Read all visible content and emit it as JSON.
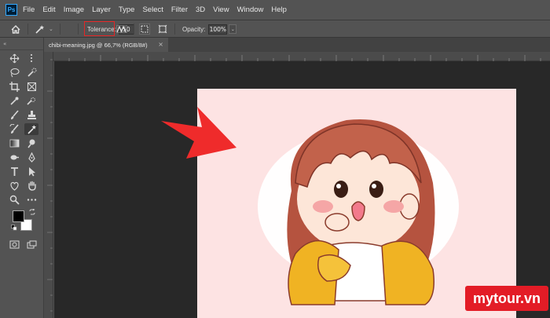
{
  "app": {
    "logo_text": "Ps"
  },
  "menu": [
    "File",
    "Edit",
    "Image",
    "Layer",
    "Type",
    "Select",
    "Filter",
    "3D",
    "View",
    "Window",
    "Help"
  ],
  "options": {
    "tolerance_label": "Tolerance:",
    "tolerance_value": "50",
    "opacity_label": "Opacity:",
    "opacity_value": "100%"
  },
  "document": {
    "tab_title": "chibi-meaning.jpg @ 66,7% (RGB/8#)",
    "tab_close": "×"
  },
  "colors": {
    "foreground": "#000000",
    "background": "#ffffff",
    "highlight_box": "#e52525",
    "arrow": "#ef2b2b",
    "canvas_bg": "#fde3e3"
  },
  "watermark": {
    "text": "mytour.vn"
  },
  "tools": [
    "move-tool",
    "artboard-tool",
    "lasso-tool",
    "quick-selection-tool",
    "crop-tool",
    "frame-tool",
    "eyedropper-tool",
    "spot-healing-tool",
    "brush-tool",
    "clone-stamp-tool",
    "history-brush-tool",
    "magic-wand-tool",
    "gradient-tool",
    "dodge-tool",
    "blur-tool",
    "pen-tool",
    "type-tool",
    "path-selection-tool",
    "custom-shape-tool",
    "hand-tool",
    "zoom-tool",
    "more-tools"
  ]
}
